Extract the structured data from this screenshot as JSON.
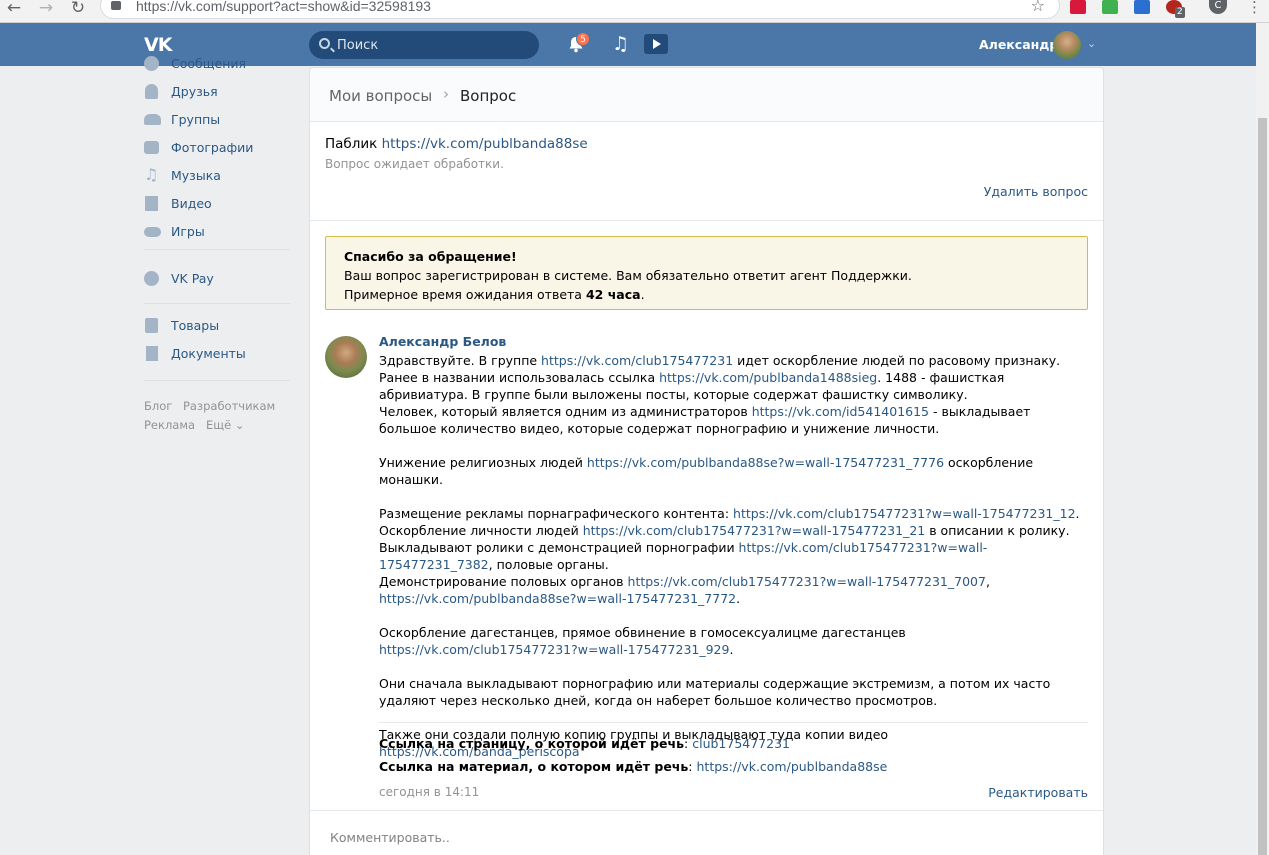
{
  "browser": {
    "url": "https://vk.com/support?act=show&id=32598193",
    "back_icon": "←",
    "forward_icon": "→",
    "reload_icon": "↻",
    "star_icon": "☆",
    "ext_badge": "2",
    "profile_letter": "C",
    "menu_icon": "⋮"
  },
  "header": {
    "logo": "VK",
    "search_placeholder": "Поиск",
    "notifications_count": "5",
    "music_icon": "♫",
    "user_name": "Александр",
    "chevron": "⌄",
    "brand_color": "#4a76a8"
  },
  "left_menu": {
    "items": [
      {
        "label": "Сообщения",
        "icon": "message-icon"
      },
      {
        "label": "Друзья",
        "icon": "friends-icon"
      },
      {
        "label": "Группы",
        "icon": "groups-icon"
      },
      {
        "label": "Фотографии",
        "icon": "camera-icon"
      },
      {
        "label": "Музыка",
        "icon": "music-icon"
      },
      {
        "label": "Видео",
        "icon": "video-icon"
      },
      {
        "label": "Игры",
        "icon": "gamepad-icon"
      },
      {
        "label": "VK Pay",
        "icon": "vkpay-icon"
      },
      {
        "label": "Товары",
        "icon": "bag-icon"
      },
      {
        "label": "Документы",
        "icon": "document-icon"
      }
    ],
    "footer": {
      "blog": "Блог",
      "developers": "Разработчикам",
      "ads": "Реклама",
      "more": "Ещё ⌄"
    }
  },
  "breadcrumb": {
    "parent": "Мои вопросы",
    "separator": "›",
    "current": "Вопрос"
  },
  "question": {
    "title_prefix": "Паблик",
    "title_link": "https://vk.com/publbanda88se",
    "status": "Вопрос ожидает обработки.",
    "delete_label": "Удалить вопрос"
  },
  "thanks_box": {
    "title": "Спасибо за обращение!",
    "line1": "Ваш вопрос зарегистрирован в системе. Вам обязательно ответит агент Поддержки.",
    "line2_prefix": "Примерное время ожидания ответа",
    "line2_bold": "42 часа",
    "line2_suffix": "."
  },
  "message": {
    "author": "Александр Белов",
    "p1a": "Здравствуйте. В группе ",
    "p1_link1": "https://vk.com/club175477231",
    "p1b": " идет оскорбление людей по расовому признаку. Ранее в названии использовалась ссылка ",
    "p1_link2": "https://vk.com/publbanda1488sieg",
    "p1c": ". 1488 - фашисткая абривиатура. В группе были выложены посты, которые содержат фашистку символику.",
    "p2a": "Человек, который является одним из администраторов ",
    "p2_link": "https://vk.com/id541401615",
    "p2b": " - выкладывает большое количество видео, которые содержат порнографию и унижение личности.",
    "p3a": "Унижение религиозных людей ",
    "p3_link": "https://vk.com/publbanda88se?w=wall-175477231_7776",
    "p3b": " оскорбление монашки.",
    "p4a": "Размещение рекламы порнаграфического контента: ",
    "p4_link1": "https://vk.com/club175477231?w=wall-175477231_12",
    "p4b": ". Оскорбление личности людей ",
    "p4_link2": "https://vk.com/club175477231?w=wall-175477231_21",
    "p4c": " в описании к ролику. Выкладывают ролики с демонстрацией порнографии ",
    "p4_link3": "https://vk.com/club175477231?w=wall-175477231_7382",
    "p4d": ", половые органы.",
    "p5a": "Демонстрирование половых органов ",
    "p5_link1": "https://vk.com/club175477231?w=wall-175477231_7007",
    "p5b": ", ",
    "p5_link2": "https://vk.com/publbanda88se?w=wall-175477231_7772",
    "p5c": ".",
    "p6a": "Оскорбление дагестанцев, прямое обвинение в гомосексуалицме дагестанцев ",
    "p6_link": "https://vk.com/club175477231?w=wall-175477231_929",
    "p6b": ".",
    "p7": "Они сначала выкладывают порнографию или материалы содержащие экстремизм, а потом их часто удаляют через несколько дней, когда он наберет большое количество просмотров.",
    "p8a": "Также они создали полную копию группы и выкладывают туда копии видео ",
    "p8_link": "https://vk.com/banda_periscopa",
    "ref1_label": "Ссылка на страницу, о которой идёт речь",
    "ref1_value": "club175477231",
    "ref2_label": "Ссылка на материал, о котором идёт речь",
    "ref2_value": "https://vk.com/publbanda88se",
    "colon": ":",
    "timestamp": "сегодня в 14:11",
    "edit_label": "Редактировать"
  },
  "comment": {
    "placeholder": "Комментировать.."
  }
}
